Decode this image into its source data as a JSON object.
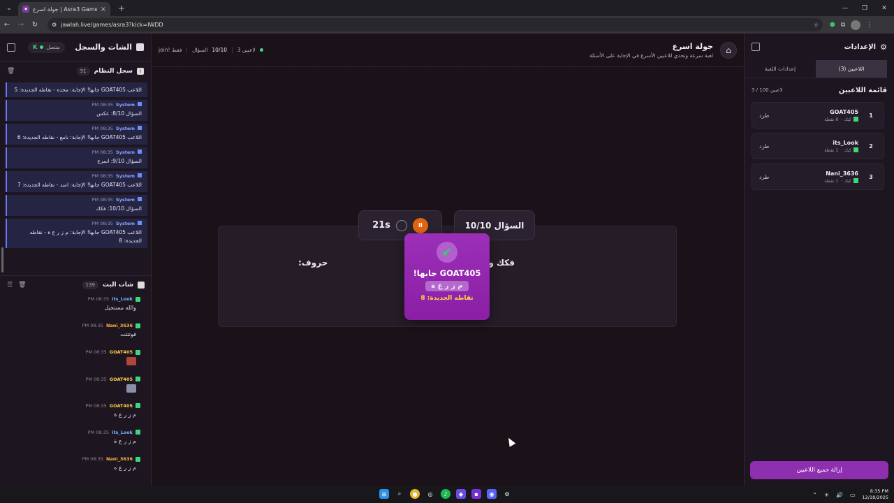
{
  "browser": {
    "tab_title": "جولة اسرع | Asra3 Game - جولة",
    "url": "jawlah.live/games/asra3?kick=IWDD"
  },
  "left_panel": {
    "title": "الشات والسجل",
    "status": "متصل",
    "system_log": {
      "title": "سجل النظام",
      "count": "51",
      "items": [
        {
          "time": "",
          "author": "",
          "text": "اللاعب GOAT405 جابها! الإجابة: مخده - نقاطه الجديدة: 5"
        },
        {
          "time": "08:35 PM",
          "author": "System",
          "text": "السؤال 8/10: عكس"
        },
        {
          "time": "08:35 PM",
          "author": "System",
          "text": "اللاعب GOAT405 جابها! الإجابة: نامع - نقاطه الجديدة: 6"
        },
        {
          "time": "08:35 PM",
          "author": "System",
          "text": "السؤال 9/10: اسرع"
        },
        {
          "time": "08:35 PM",
          "author": "System",
          "text": "اللاعب GOAT405 جابها! الإجابة: اسد - نقاطه الجديدة: 7"
        },
        {
          "time": "08:35 PM",
          "author": "System",
          "text": "السؤال 10/10: فكك"
        },
        {
          "time": "08:35 PM",
          "author": "System",
          "text": "اللاعب GOAT405 جابها! الإجابة: م ز ر ع ة - نقاطه الجديدة: 8"
        }
      ]
    },
    "stream_chat": {
      "title": "شات البث",
      "count": "139",
      "messages": [
        {
          "user": "its_Look",
          "time": "08:35 PM",
          "text": "والله مستحيل",
          "color": "blue"
        },
        {
          "user": "Nani_3636",
          "time": "08:35 PM",
          "text": "فوتتتت",
          "color": "orange"
        },
        {
          "user": "GOAT405",
          "time": "08:35 PM",
          "text": "",
          "color": "yellow",
          "emote": true
        },
        {
          "user": "GOAT405",
          "time": "08:35 PM",
          "text": "",
          "color": "yellow",
          "emote": true
        },
        {
          "user": "GOAT405",
          "time": "08:35 PM",
          "text": "م ز ر ع ة",
          "color": "yellow"
        },
        {
          "user": "its_Look",
          "time": "08:35 PM",
          "text": "م ز ر ع ة",
          "color": "blue"
        },
        {
          "user": "Nani_3636",
          "time": "08:35 PM",
          "text": "م ز ر ع ه",
          "color": "orange"
        }
      ]
    }
  },
  "center": {
    "title": "جولة اسرع",
    "subtitle": "لعبة سرعة وتحدي للاعبين الأسرع في الإجابة على الأسئلة",
    "players_count": "3 لاعبين",
    "question_label": "السؤال",
    "question_progress": "10/10",
    "join_note": "join! فقط",
    "timer": "21s",
    "question_number": "السؤال 10/10",
    "question_text_right": "فكك و",
    "question_text_left": "حروف:",
    "toast": {
      "title": "GOAT405 جابها!",
      "answer": "م ز ر ع ة",
      "points": "نقاطه الجديدة: 8"
    }
  },
  "right_panel": {
    "title": "الإعدادات",
    "tabs": [
      "اللاعبين (3)",
      "إعدادات اللعبة"
    ],
    "players_list_title": "قائمة اللاعبين",
    "players_capacity": "3 / 100 لاعبين",
    "kick_label": "طرد",
    "players": [
      {
        "rank": "1",
        "name": "GOAT405",
        "platform": "كيك",
        "points": "8 نقطة"
      },
      {
        "rank": "2",
        "name": "its_Look",
        "platform": "كيك",
        "points": "1 نقطة"
      },
      {
        "rank": "3",
        "name": "Nani_3636",
        "platform": "كيك",
        "points": "1 نقطة"
      }
    ],
    "remove_all_label": "إزالة جميع اللاعبين"
  },
  "taskbar": {
    "time": "8:35 PM",
    "date": "12/18/2025"
  },
  "colors": {
    "accent": "#8e2fb0",
    "toast": "#9b2fb7",
    "online": "#3fd67b",
    "pause": "#e0650f"
  }
}
